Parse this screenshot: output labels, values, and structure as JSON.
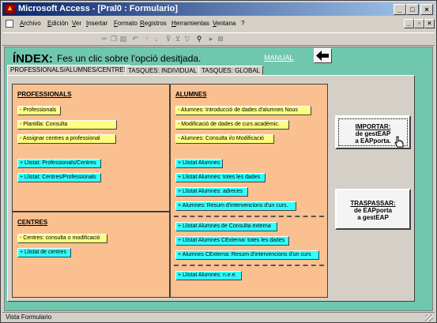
{
  "window": {
    "title": "Microsoft Access - [Pral0 : Formulario]",
    "minimize": "_",
    "maximize": "□",
    "close": "×"
  },
  "menu": {
    "items": [
      "Archivo",
      "Edición",
      "Ver",
      "Insertar",
      "Formato",
      "Registros",
      "Herramientas",
      "Ventana",
      "?"
    ],
    "mdi_minimize": "_",
    "mdi_restore": "▫",
    "mdi_close": "×"
  },
  "toolbar": {
    "icons": [
      "cut-icon",
      "copy-icon",
      "paste-icon",
      "undo-icon",
      "sort-asc-icon",
      "sort-desc-icon",
      "filter-selection-icon",
      "filter-form-icon",
      "apply-filter-icon",
      "find-icon",
      "new-record-icon",
      "delete-record-icon"
    ]
  },
  "header": {
    "title": "ÍNDEX:",
    "subtitle": "Fes un clic sobre l'opció desitjada.",
    "manual_link": "MANUAL"
  },
  "tabs": [
    {
      "label": "PROFESSIONALS/ALUMNES/CENTRES",
      "active": true
    },
    {
      "label": "TASQUES: INDIVIDUAL",
      "active": false
    },
    {
      "label": "TASQUES: GLOBAL",
      "active": false
    }
  ],
  "professionals": {
    "title": "PROFESSIONALS",
    "buttons": [
      {
        "label": "- Professionals",
        "color": "yellow"
      },
      {
        "label": "- Plantilla: Consulta",
        "color": "yellow"
      },
      {
        "label": "- Assignar centres a professional",
        "color": "yellow"
      },
      {
        "label": "+ Llistat: Professionals/Centres",
        "color": "cyan"
      },
      {
        "label": "+ Llistat: Centres/Professionals",
        "color": "cyan"
      }
    ]
  },
  "centres": {
    "title": "CENTRES",
    "buttons": [
      {
        "label": "- Centres: consulta o modificació",
        "color": "yellow"
      },
      {
        "label": "+ Llistat de centres",
        "color": "cyan"
      }
    ]
  },
  "alumnes": {
    "title": "ALUMNES",
    "buttons": [
      {
        "label": "- Alumnes: Introducció de dades d'alumnes Nous",
        "color": "yellow"
      },
      {
        "label": "- Modificació de dades de curs acadèmic.",
        "color": "yellow"
      },
      {
        "label": "- Alumnes: Consulta i/o Modificació",
        "color": "yellow"
      },
      {
        "label": "+ Llistat Alumnes",
        "color": "cyan"
      },
      {
        "label": "+ Llistat Alumnes: totes les dades",
        "color": "cyan"
      },
      {
        "label": "+ Llistat Alumnes: adreces",
        "color": "cyan"
      },
      {
        "label": "+ Alumnes: Resum d'intervencions d'un curs.",
        "color": "cyan"
      },
      {
        "label": "+ Llistat Alumnes de Consulta externa",
        "color": "cyan"
      },
      {
        "label": "+ Llistat Alumnes CExterna: totes les dades",
        "color": "cyan"
      },
      {
        "label": "+ Alumnes CExterna: Resum d'intervencions d'un curs",
        "color": "cyan"
      },
      {
        "label": "+ Llistat Alumnes: n.e.e.",
        "color": "cyan"
      }
    ]
  },
  "import_button": {
    "line1": "IMPORTAR:",
    "line2": "de gestEAP",
    "line3": "a EAPporta."
  },
  "transfer_button": {
    "line1": "TRASPASSAR:",
    "line2": "de EAPporta",
    "line3": "a gestEAP"
  },
  "status": {
    "text": "Vista Formulario"
  },
  "colors": {
    "background": "#6fc7ae",
    "panel": "#fac090",
    "yellow_button": "#ffff80",
    "cyan_button": "#33ffff",
    "title_bar": "#0a246a"
  }
}
